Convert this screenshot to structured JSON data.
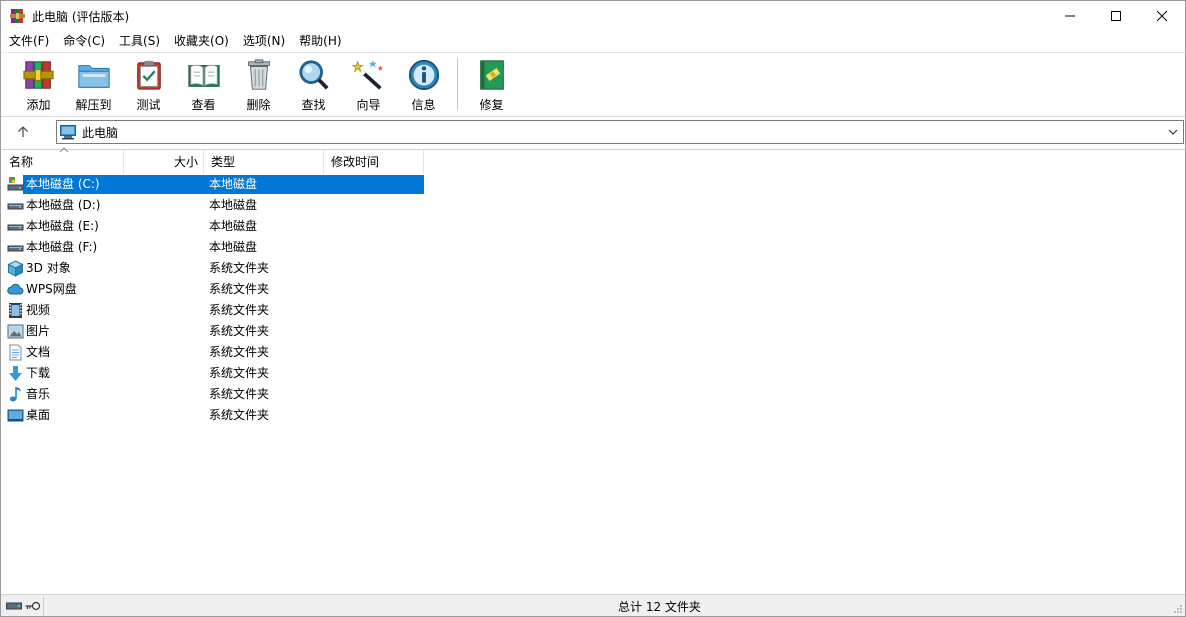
{
  "window": {
    "title": "此电脑 (评估版本)",
    "controls": [
      "minimize-icon",
      "maximize-icon",
      "close-icon"
    ]
  },
  "menu": [
    {
      "label": "文件(F)"
    },
    {
      "label": "命令(C)"
    },
    {
      "label": "工具(S)"
    },
    {
      "label": "收藏夹(O)"
    },
    {
      "label": "选项(N)"
    },
    {
      "label": "帮助(H)"
    }
  ],
  "toolbar": {
    "items": [
      {
        "label": "添加",
        "icon": "archive-books-icon"
      },
      {
        "label": "解压到",
        "icon": "folder-extract-icon"
      },
      {
        "label": "测试",
        "icon": "clipboard-check-icon"
      },
      {
        "label": "查看",
        "icon": "open-book-icon"
      },
      {
        "label": "删除",
        "icon": "trash-bin-icon"
      },
      {
        "label": "查找",
        "icon": "magnifier-icon"
      },
      {
        "label": "向导",
        "icon": "magic-wand-icon"
      },
      {
        "label": "信息",
        "icon": "info-icon"
      },
      {
        "label": "修复",
        "icon": "first-aid-book-icon"
      }
    ]
  },
  "address": {
    "up_icon": "up-arrow-icon",
    "path": "此电脑",
    "path_icon": "computer-icon",
    "dropdown_icon": "chevron-down-icon"
  },
  "columns": {
    "name": "名称",
    "size": "大小",
    "type": "类型",
    "modified": "修改时间"
  },
  "rows": [
    {
      "name": "本地磁盘 (C:)",
      "type": "本地磁盘",
      "icon": "system-drive-icon",
      "selected": true
    },
    {
      "name": "本地磁盘 (D:)",
      "type": "本地磁盘",
      "icon": "drive-icon"
    },
    {
      "name": "本地磁盘 (E:)",
      "type": "本地磁盘",
      "icon": "drive-icon"
    },
    {
      "name": "本地磁盘 (F:)",
      "type": "本地磁盘",
      "icon": "drive-icon"
    },
    {
      "name": "3D 对象",
      "type": "系统文件夹",
      "icon": "3d-objects-icon"
    },
    {
      "name": "WPS网盘",
      "type": "系统文件夹",
      "icon": "cloud-icon"
    },
    {
      "name": "视频",
      "type": "系统文件夹",
      "icon": "video-icon"
    },
    {
      "name": "图片",
      "type": "系统文件夹",
      "icon": "picture-icon"
    },
    {
      "name": "文档",
      "type": "系统文件夹",
      "icon": "document-icon"
    },
    {
      "name": "下载",
      "type": "系统文件夹",
      "icon": "download-icon"
    },
    {
      "name": "音乐",
      "type": "系统文件夹",
      "icon": "music-icon"
    },
    {
      "name": "桌面",
      "type": "系统文件夹",
      "icon": "desktop-icon"
    }
  ],
  "status": {
    "summary": "总计 12 文件夹"
  },
  "colors": {
    "selection": "#0078d7",
    "accent": "#0078d7"
  }
}
